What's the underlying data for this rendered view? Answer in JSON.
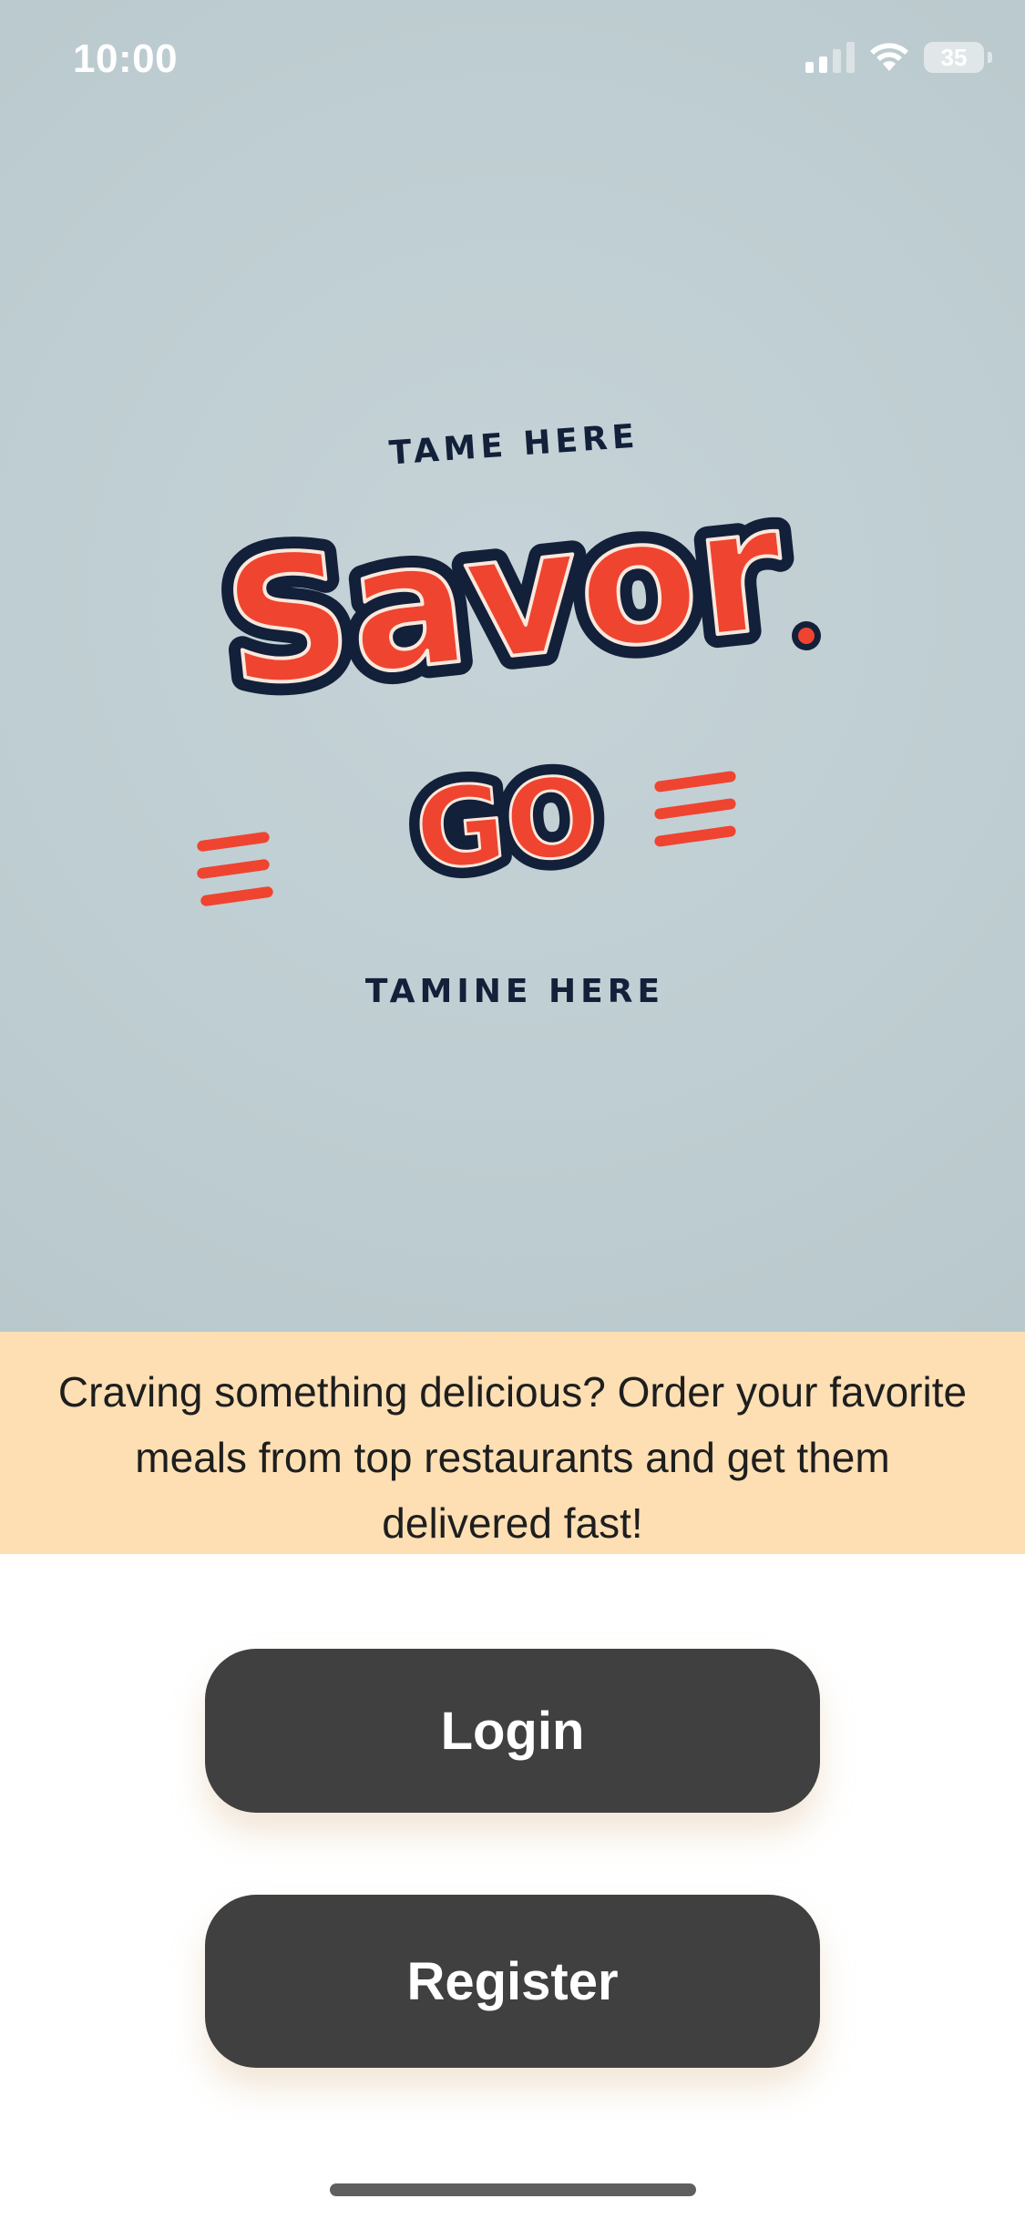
{
  "status_bar": {
    "time": "10:00",
    "battery_level": "35",
    "icons": [
      "signal-icon",
      "wifi-icon",
      "battery-icon"
    ]
  },
  "logo": {
    "top_text": "TAME HERE",
    "main_text": "Savor",
    "sub_text": "GO",
    "bottom_text": "TAMINE HERE"
  },
  "tagline": {
    "text": "Craving something delicious? Order your favorite meals from top restaurants and get them delivered fast!"
  },
  "buttons": {
    "login_label": "Login",
    "register_label": "Register"
  },
  "colors": {
    "hero_background": "#c0cfd3",
    "tagline_background": "#fddfb3",
    "button_background": "#404040",
    "button_text": "#ffffff",
    "logo_red": "#ef4430",
    "logo_outline": "#13203a"
  }
}
